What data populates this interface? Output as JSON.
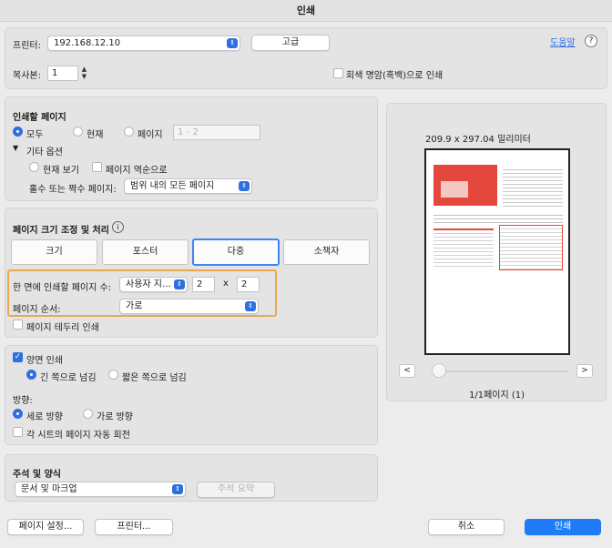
{
  "window": {
    "title": "인쇄"
  },
  "header": {
    "printer_label": "프린터:",
    "printer_value": "192.168.12.10",
    "advanced_button": "고급",
    "help_link": "도움말",
    "help_icon": "?",
    "copies_label": "복사본:",
    "copies_value": "1",
    "grayscale_label": "회색 명암(흑백)으로 인쇄",
    "grayscale_checked": false
  },
  "pages_to_print": {
    "heading": "인쇄할 페이지",
    "all_label": "모두",
    "current_label": "현재",
    "pages_label": "페이지",
    "pages_range_placeholder": "1 - 2",
    "selected": "all",
    "more_options_label": "기타 옵션",
    "current_view_label": "현재 보기",
    "reverse_label": "페이지 역순으로",
    "odd_even_label": "홀수 또는 짝수 페이지:",
    "odd_even_value": "범위 내의 모든 페이지"
  },
  "page_sizing": {
    "heading": "페이지 크기 조정 및 처리",
    "info_icon": "i",
    "tabs": [
      "크기",
      "포스터",
      "다중",
      "소책자"
    ],
    "active_tab": "다중",
    "pages_per_sheet_label": "한 면에 인쇄할 페이지 수:",
    "pages_per_sheet_value": "사용자 지…",
    "cols": "2",
    "times": "x",
    "rows": "2",
    "page_order_label": "페이지 순서:",
    "page_order_value": "가로",
    "print_border_label": "페이지 테두리 인쇄",
    "highlight_color": "#e9a84d"
  },
  "duplex": {
    "print_both_sides_label": "양면 인쇄",
    "print_both_sides_checked": true,
    "long_edge_label": "긴 쪽으로 넘김",
    "short_edge_label": "짧은 쪽으로 넘김",
    "flip_selected": "long",
    "orientation_heading": "방향:",
    "portrait_label": "세로 방향",
    "landscape_label": "가로 방향",
    "orientation_selected": "portrait",
    "auto_rotate_label": "각 시트의 페이지 자동 회전"
  },
  "comments": {
    "heading": "주석 및 양식",
    "value": "문서 및 마크업",
    "summarize_button": "주석 요약"
  },
  "preview": {
    "dimensions": "209.9 x 297.04 밀리미터",
    "prev_icon": "<",
    "next_icon": ">",
    "page_indicator": "1/1페이지 (1)"
  },
  "footer": {
    "page_setup_button": "페이지 설정...",
    "printer_button": "프린터...",
    "cancel_button": "취소",
    "print_button": "인쇄"
  },
  "colors": {
    "accent": "#2f6fe0",
    "print_button": "#1f7cf6",
    "tab_focus": "#3d86f4",
    "thumb_red": "#e4473b"
  }
}
